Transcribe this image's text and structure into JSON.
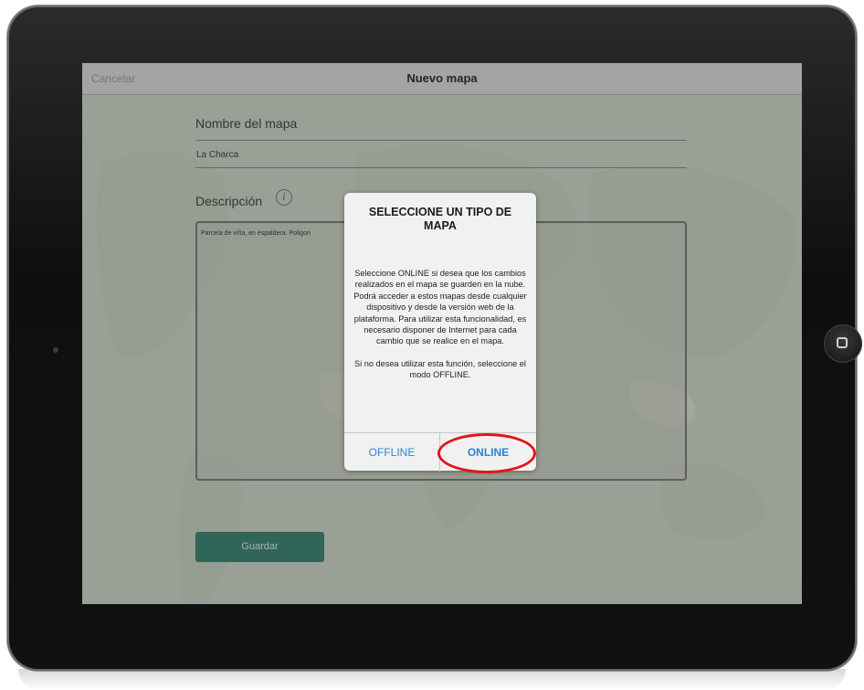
{
  "navbar": {
    "cancel_label": "Cancelar",
    "title": "Nuevo mapa"
  },
  "form": {
    "name_label": "Nombre del mapa",
    "name_value": "La Charca",
    "description_label": "Descripción",
    "info_icon": "info-icon",
    "description_value": "Parcela de viña, en espaldera. Poligon",
    "save_label": "Guardar"
  },
  "dialog": {
    "title": "SELECCIONE UN TIPO DE MAPA",
    "body": "Seleccione ONLINE si desea que los cambios realizados en el mapa se guarden en la nube. Podrá acceder a estos mapas desde cualquier dispositivo y desde la versión web de la plataforma. Para utilizar esta funcionalidad, es necesario disponer de Internet para cada cambio que se realice en el mapa.",
    "body2": "Si no desea utilizar esta función, seleccione el modo OFFLINE.",
    "offline_label": "OFFLINE",
    "online_label": "ONLINE"
  },
  "device": {
    "home_icon": "home-button-icon"
  },
  "colors": {
    "accent_blue": "#2f7fd6",
    "save_green": "#2b7864",
    "highlight_red": "#e0161b"
  }
}
